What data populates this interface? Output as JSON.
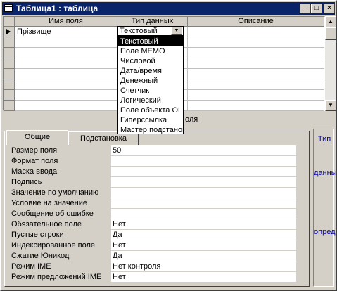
{
  "window": {
    "title": "Таблица1 : таблица",
    "buttons": {
      "minimize": "_",
      "maximize": "□",
      "close": "×"
    }
  },
  "grid": {
    "headers": [
      "Имя поля",
      "Тип данных",
      "Описание"
    ],
    "rows": [
      {
        "name": "Прізвище",
        "type": "Текстовый",
        "description": ""
      }
    ]
  },
  "dropdown": {
    "value": "Текстовый",
    "options": [
      "Текстовый",
      "Поле МЕМО",
      "Числовой",
      "Дата/время",
      "Денежный",
      "Счетчик",
      "Логический",
      "Поле объекта OLE",
      "Гиперссылка",
      "Мастер подстановок"
    ]
  },
  "field_properties_label": "оля",
  "tabs": [
    "Общие",
    "Подстановка"
  ],
  "properties": [
    {
      "label": "Размер поля",
      "value": "50"
    },
    {
      "label": "Формат поля",
      "value": ""
    },
    {
      "label": "Маска ввода",
      "value": ""
    },
    {
      "label": "Подпись",
      "value": ""
    },
    {
      "label": "Значение по умолчанию",
      "value": ""
    },
    {
      "label": "Условие на значение",
      "value": ""
    },
    {
      "label": "Сообщение об ошибке",
      "value": ""
    },
    {
      "label": "Обязательное поле",
      "value": "Нет"
    },
    {
      "label": "Пустые строки",
      "value": "Да"
    },
    {
      "label": "Индексированное поле",
      "value": "Нет"
    },
    {
      "label": "Сжатие Юникод",
      "value": "Да"
    },
    {
      "label": "Режим IME",
      "value": "Нет контроля"
    },
    {
      "label": "Режим предложений IME",
      "value": "Нет"
    }
  ],
  "hint_text": "Тип данных опред",
  "hint_words": [
    "Тип",
    "данных",
    "опред"
  ]
}
